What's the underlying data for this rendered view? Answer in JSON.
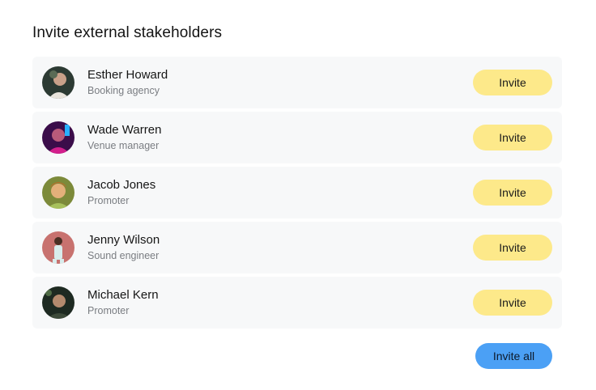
{
  "title": "Invite external stakeholders",
  "people": [
    {
      "name": "Esther Howard",
      "role": "Booking agency",
      "action": "Invite"
    },
    {
      "name": "Wade Warren",
      "role": "Venue manager",
      "action": "Invite"
    },
    {
      "name": "Jacob Jones",
      "role": "Promoter",
      "action": "Invite"
    },
    {
      "name": "Jenny Wilson",
      "role": "Sound engineer",
      "action": "Invite"
    },
    {
      "name": "Michael Kern",
      "role": "Promoter",
      "action": "Invite"
    }
  ],
  "invite_all_label": "Invite all",
  "colors": {
    "invite_button": "#fde98a",
    "invite_all_button": "#4ba0f5",
    "row_background": "#f7f8f9"
  }
}
